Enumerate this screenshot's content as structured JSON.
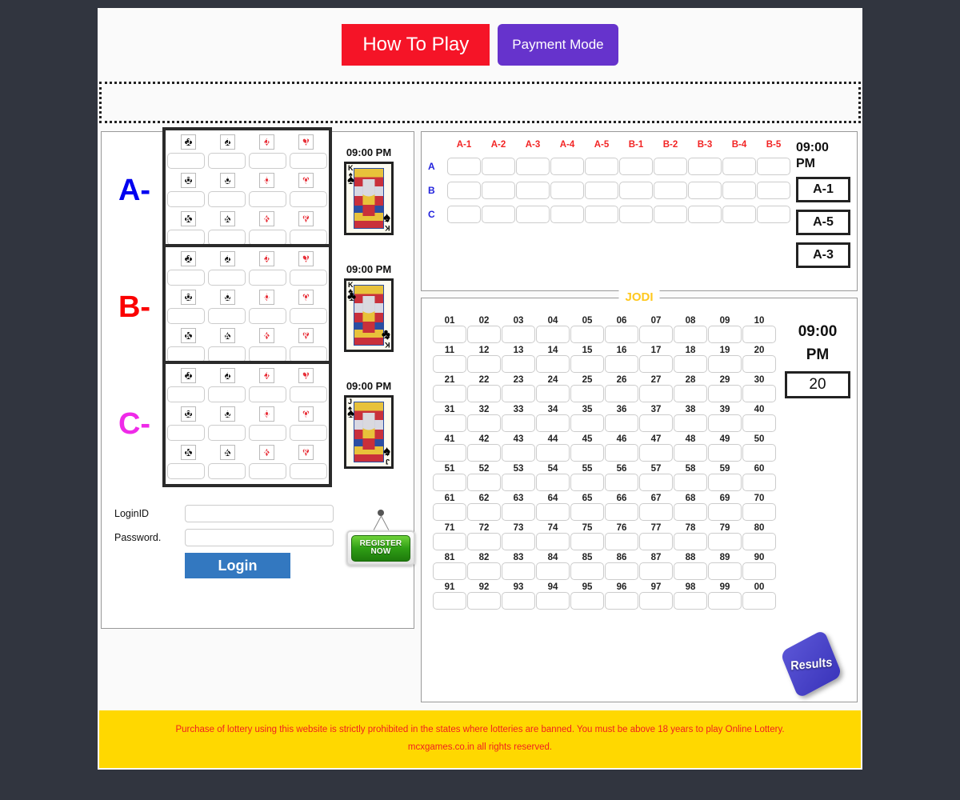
{
  "header": {
    "how_to_play": "How To Play",
    "payment_mode": "Payment Mode",
    "colors": {
      "how_to_play_bg": "#f51427",
      "payment_mode_bg": "#6633cc"
    }
  },
  "marquee": {
    "text": ""
  },
  "abc_sections": [
    {
      "letter": "A-",
      "color": "#0000f0",
      "time": "09:00 PM",
      "card": {
        "rank": "K",
        "suit": "spade",
        "suit_glyph": "♠",
        "color": "#111111"
      },
      "rows": [
        {
          "rank": "J",
          "suits": [
            "♣",
            "♠",
            "♦",
            "♥"
          ]
        },
        {
          "rank": "Q",
          "suits": [
            "♣",
            "♠",
            "♦",
            "♥"
          ]
        },
        {
          "rank": "K",
          "suits": [
            "♣",
            "♠",
            "♦",
            "♥"
          ]
        }
      ]
    },
    {
      "letter": "B-",
      "color": "#fb0000",
      "time": "09:00 PM",
      "card": {
        "rank": "K",
        "suit": "club",
        "suit_glyph": "♣",
        "color": "#111111"
      },
      "rows": [
        {
          "rank": "J",
          "suits": [
            "♣",
            "♠",
            "♦",
            "♥"
          ]
        },
        {
          "rank": "Q",
          "suits": [
            "♣",
            "♠",
            "♦",
            "♥"
          ]
        },
        {
          "rank": "K",
          "suits": [
            "♣",
            "♠",
            "♦",
            "♥"
          ]
        }
      ]
    },
    {
      "letter": "C-",
      "color": "#ef2ae8",
      "time": "09:00 PM",
      "card": {
        "rank": "J",
        "suit": "spade",
        "suit_glyph": "♠",
        "color": "#111111"
      },
      "rows": [
        {
          "rank": "J",
          "suits": [
            "♣",
            "♠",
            "♦",
            "♥"
          ]
        },
        {
          "rank": "Q",
          "suits": [
            "♣",
            "♠",
            "♦",
            "♥"
          ]
        },
        {
          "rank": "K",
          "suits": [
            "♣",
            "♠",
            "♦",
            "♥"
          ]
        }
      ]
    }
  ],
  "login": {
    "loginid_label": "LoginID",
    "password_label": "Password.",
    "loginid_value": "",
    "password_value": "",
    "loginid_placeholder": "",
    "password_placeholder": "",
    "login_button": "Login",
    "register_line1": "REGISTER",
    "register_line2": "NOW"
  },
  "ab_panel": {
    "columns": [
      "A-1",
      "A-2",
      "A-3",
      "A-4",
      "A-5",
      "B-1",
      "B-2",
      "B-3",
      "B-4",
      "B-5"
    ],
    "rows": [
      {
        "label": "A",
        "result": "A-1"
      },
      {
        "label": "B",
        "result": "A-5"
      },
      {
        "label": "C",
        "result": "A-3"
      }
    ],
    "time_line1": "09:00",
    "time_line2": "PM"
  },
  "jodi": {
    "legend": "JODI",
    "time_line1": "09:00",
    "time_line2": "PM",
    "result": "20",
    "rows": [
      [
        "01",
        "02",
        "03",
        "04",
        "05",
        "06",
        "07",
        "08",
        "09",
        "10"
      ],
      [
        "11",
        "12",
        "13",
        "14",
        "15",
        "16",
        "17",
        "18",
        "19",
        "20"
      ],
      [
        "21",
        "22",
        "23",
        "24",
        "25",
        "26",
        "27",
        "28",
        "29",
        "30"
      ],
      [
        "31",
        "32",
        "33",
        "34",
        "35",
        "36",
        "37",
        "38",
        "39",
        "40"
      ],
      [
        "41",
        "42",
        "43",
        "44",
        "45",
        "46",
        "47",
        "48",
        "49",
        "50"
      ],
      [
        "51",
        "52",
        "53",
        "54",
        "55",
        "56",
        "57",
        "58",
        "59",
        "60"
      ],
      [
        "61",
        "62",
        "63",
        "64",
        "65",
        "66",
        "67",
        "68",
        "69",
        "70"
      ],
      [
        "71",
        "72",
        "73",
        "74",
        "75",
        "76",
        "77",
        "78",
        "79",
        "80"
      ],
      [
        "81",
        "82",
        "83",
        "84",
        "85",
        "86",
        "87",
        "88",
        "89",
        "90"
      ],
      [
        "91",
        "92",
        "93",
        "94",
        "95",
        "96",
        "97",
        "98",
        "99",
        "00"
      ]
    ],
    "results_badge": "Results"
  },
  "footer": {
    "line1": "Purchase of lottery using this website is strictly prohibited in the states where lotteries are banned. You must be above 18 years to play Online Lottery.",
    "line2": "mcxgames.co.in all rights reserved."
  }
}
